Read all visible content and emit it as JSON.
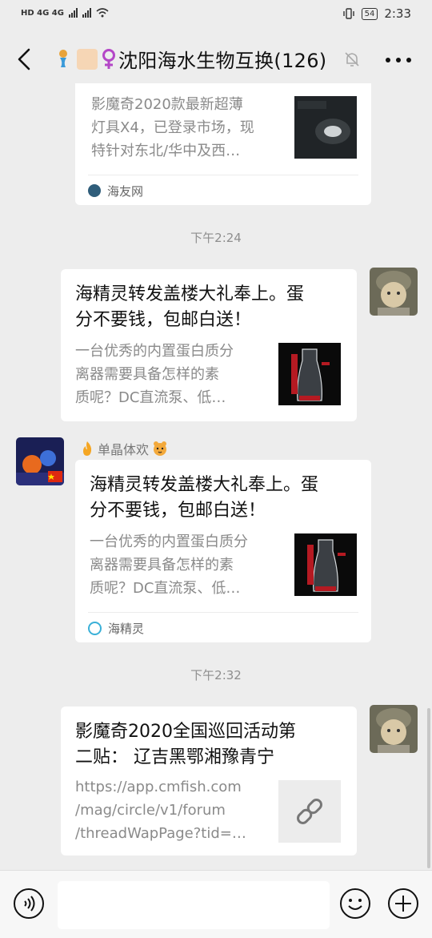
{
  "status_bar": {
    "network_left": "HD 4G 4G",
    "battery": "54",
    "time": "2:33"
  },
  "header": {
    "title": "沈阳海水生物互换(126)",
    "back_icon": "chevron-left-icon",
    "mute_icon": "bell-off-icon",
    "more_icon": "more-dots-icon"
  },
  "messages": [
    {
      "type": "link-card",
      "side": "left-partial",
      "desc": [
        "影魔奇2020款最新超薄",
        "灯具X4，已登录市场，现",
        "特针对东北/华中及西…"
      ],
      "source": "海友网"
    },
    {
      "type": "timestamp",
      "text": "下午2:24"
    },
    {
      "type": "link-card",
      "side": "right",
      "title": [
        "海精灵转发盖楼大礼奉上。蛋",
        "分不要钱，包邮白送！"
      ],
      "desc": [
        "一台优秀的内置蛋白质分",
        "离器需要具备怎样的素",
        "质呢？DC直流泵、低…"
      ]
    },
    {
      "type": "link-card",
      "side": "left",
      "sender": "单晶体欢",
      "title": [
        "海精灵转发盖楼大礼奉上。蛋",
        "分不要钱，包邮白送！"
      ],
      "desc": [
        "一台优秀的内置蛋白质分",
        "离器需要具备怎样的素",
        "质呢？DC直流泵、低…"
      ],
      "source": "海精灵"
    },
    {
      "type": "timestamp",
      "text": "下午2:32"
    },
    {
      "type": "link-card",
      "side": "right",
      "title": [
        "影魔奇2020全国巡回活动第",
        "二贴： 辽吉黑鄂湘豫青宁"
      ],
      "desc": [
        "https://app.cmfish.com",
        "/mag/circle/v1/forum",
        "/threadWapPage?tid=…"
      ],
      "thumb_icon": "link-icon"
    }
  ],
  "input_bar": {
    "voice_icon": "voice-icon",
    "emoji_icon": "emoji-icon",
    "plus_icon": "plus-circle-icon",
    "placeholder": ""
  }
}
